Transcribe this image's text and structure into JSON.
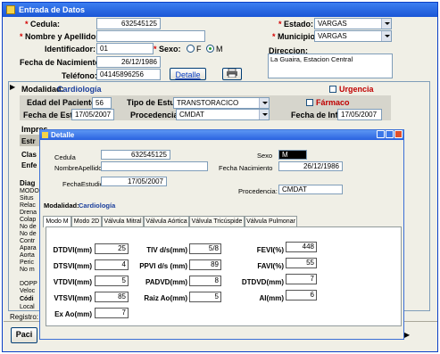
{
  "window": {
    "title": "Entrada de Datos"
  },
  "patient": {
    "cedula_label": "Cedula:",
    "cedula": "632545125",
    "nombre_label": "Nombre y Apellidos:",
    "nombre": "",
    "identificador_label": "Identificador:",
    "identificador": "01",
    "fecha_nac_label": "Fecha de Nacimiento:",
    "fecha_nac": "26/12/1986",
    "telefono_label": "Teléfono:",
    "telefono": "04145896256",
    "estado_label": "Estado:",
    "estado": "VARGAS",
    "municipio_label": "Municipio",
    "municipio": "VARGAS",
    "sexo_label": "Sexo:",
    "sexo_f": "F",
    "sexo_m": "M",
    "direccion_label": "Direccion:",
    "direccion": "La Guaira, Estacion Central",
    "detalle_button": "Detalle"
  },
  "study": {
    "modalidad_label": "Modalidad:",
    "modalidad": "Cardiología",
    "urgencia_label": "Urgencia",
    "edad_label": "Edad del Paciente:",
    "edad": "56",
    "tipo_label": "Tipo de Estudio:",
    "tipo": "TRANSTORACICO",
    "farmaco_label": "Fármaco",
    "fecha_est_label": "Fecha de Est:",
    "fecha_est": "17/05/2007",
    "procedencia_label": "Procedencia:",
    "procedencia": "CMDAT",
    "fecha_inf_label": "Fecha de Inf:",
    "fecha_inf": "17/05/2007",
    "impresion_label": "Impres"
  },
  "sidebar_partial": [
    "Estr",
    "Clas",
    "Enfe",
    "Diag",
    "MODO",
    "Situs",
    "Relac",
    "Drena",
    "Colap",
    "No de",
    "No de",
    "Contr",
    "Apara",
    "Aorta",
    "Peric",
    "No m",
    "DOPP",
    "Veloc",
    "Códi",
    "Local"
  ],
  "footer": {
    "registro_label": "Registro:",
    "pacientes_button": "Paci"
  },
  "dialog": {
    "title": "Detalle",
    "cedula_label": "Cedula",
    "cedula": "632545125",
    "sexo_label": "Sexo",
    "sexo": "M",
    "nombre_label": "NombreApellidos",
    "nombre": "",
    "fecha_nac_label": "Fecha Nacimiento",
    "fecha_nac": "26/12/1986",
    "fecha_est_label": "FechaEstudio:",
    "fecha_est": "17/05/2007",
    "procedencia_label": "Procedencia:",
    "procedencia": "CMDAT",
    "modalidad_label": "Modalidad:",
    "modalidad": "Cardiología",
    "tabs": [
      "Modo M",
      "Modo 2D",
      "Válvula Mitral",
      "Válvula Aórtica",
      "Válvula Tricúspide",
      "Válvula Pulmonar"
    ],
    "measures": [
      {
        "label": "DTDVI(mm)",
        "value": "25"
      },
      {
        "label": "DTSVI(mm)",
        "value": "4"
      },
      {
        "label": "VTDVI(mm)",
        "value": "5"
      },
      {
        "label": "VTSVI(mm)",
        "value": "85"
      },
      {
        "label": "Ex Ao(mm)",
        "value": "7"
      },
      {
        "label": "TIV d/s(mm)",
        "value": "5/8"
      },
      {
        "label": "PPVI d/s (mm)",
        "value": "89"
      },
      {
        "label": "PADVD(mm)",
        "value": "8"
      },
      {
        "label": "Raiz Ao(mm)",
        "value": "5"
      },
      {
        "label": "FEVI(%)",
        "value": "448"
      },
      {
        "label": "FAVI(%)",
        "value": "55"
      },
      {
        "label": "DTDVD(mm)",
        "value": "7"
      },
      {
        "label": "AI(mm)",
        "value": "6"
      }
    ]
  },
  "colors": {
    "titlebar": "#1a56d6",
    "required_mark": "#d40000",
    "modalidad_value": "#1b3f9c"
  }
}
